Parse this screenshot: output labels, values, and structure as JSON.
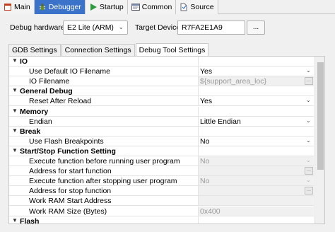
{
  "tabs": [
    {
      "label": "Main",
      "icon": "main-icon"
    },
    {
      "label": "Debugger",
      "icon": "debugger-icon"
    },
    {
      "label": "Startup",
      "icon": "play-icon"
    },
    {
      "label": "Common",
      "icon": "common-icon"
    },
    {
      "label": "Source",
      "icon": "source-icon"
    }
  ],
  "active_tab": "Debugger",
  "accent_color": "#3a73c9",
  "debug_hardware": {
    "label": "Debug hardware:",
    "value": "E2 Lite (ARM)"
  },
  "target_device": {
    "label": "Target Device:",
    "value": "R7FA2E1A9",
    "browse_label": "..."
  },
  "sub_tabs": [
    "GDB Settings",
    "Connection Settings",
    "Debug Tool Settings"
  ],
  "active_sub_tab": "Debug Tool Settings",
  "rows": [
    {
      "kind": "category",
      "name": "IO",
      "expanded": "▼"
    },
    {
      "kind": "prop",
      "name": "Use Default IO Filename",
      "value": "Yes",
      "dropdown": "⌄"
    },
    {
      "kind": "prop",
      "name": "IO Filename",
      "value": "${support_area_loc}",
      "disabled": true,
      "button": "..."
    },
    {
      "kind": "category",
      "name": "General Debug",
      "expanded": "▼"
    },
    {
      "kind": "prop",
      "name": "Reset After Reload",
      "value": "Yes",
      "dropdown": "⌄"
    },
    {
      "kind": "category",
      "name": "Memory",
      "expanded": "▼"
    },
    {
      "kind": "prop",
      "name": "Endian",
      "value": "Little Endian",
      "dropdown": "⌄"
    },
    {
      "kind": "category",
      "name": "Break",
      "expanded": "▼"
    },
    {
      "kind": "prop",
      "name": "Use Flash Breakpoints",
      "value": "No",
      "dropdown": "⌄"
    },
    {
      "kind": "category",
      "name": "Start/Stop Function Setting",
      "expanded": "▼"
    },
    {
      "kind": "prop",
      "name": "Execute function before running user program",
      "value": "No",
      "disabled": true,
      "dropdown": "⌄"
    },
    {
      "kind": "prop",
      "name": "Address for start function",
      "value": "",
      "disabled": true,
      "button": "..."
    },
    {
      "kind": "prop",
      "name": "Execute function after stopping user program",
      "value": "No",
      "disabled": true,
      "dropdown": "⌄"
    },
    {
      "kind": "prop",
      "name": "Address for stop function",
      "value": "",
      "disabled": true,
      "button": "..."
    },
    {
      "kind": "prop",
      "name": "Work RAM Start Address",
      "value": "",
      "disabled": true
    },
    {
      "kind": "prop",
      "name": "Work RAM Size (Bytes)",
      "value": "0x400",
      "disabled": true
    },
    {
      "kind": "category",
      "name": "Flash",
      "expanded": "▼"
    }
  ]
}
